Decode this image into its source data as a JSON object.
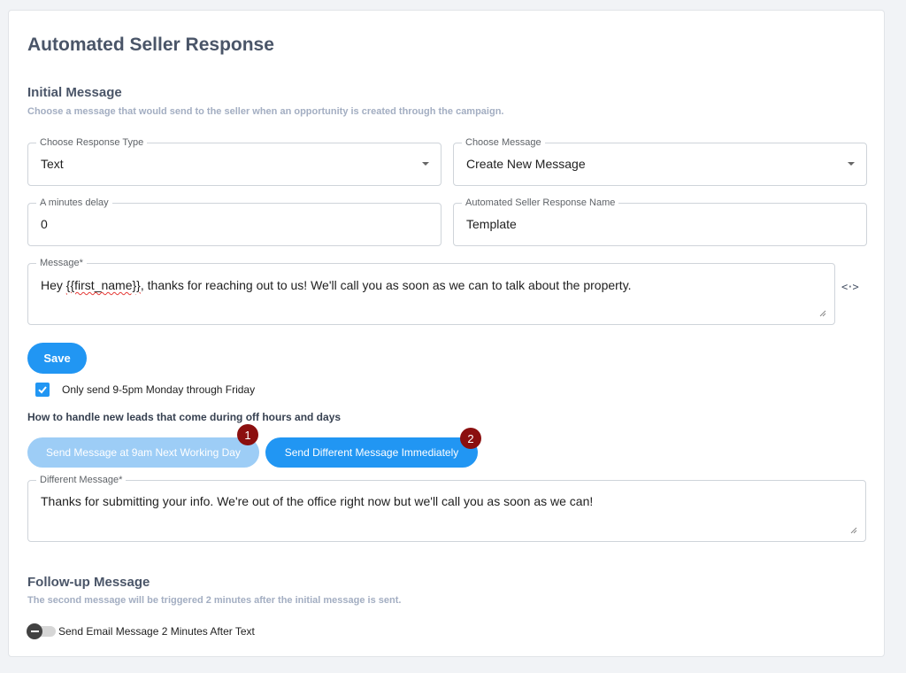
{
  "page_title": "Automated Seller Response",
  "initial": {
    "title": "Initial Message",
    "subtitle": "Choose a message that would send to the seller when an opportunity is created through the campaign."
  },
  "fields": {
    "response_type": {
      "label": "Choose Response Type",
      "value": "Text"
    },
    "choose_message": {
      "label": "Choose Message",
      "value": "Create New Message"
    },
    "delay": {
      "label": "A minutes delay",
      "value": "0"
    },
    "response_name": {
      "label": "Automated Seller Response Name",
      "value": "Template"
    },
    "message": {
      "label": "Message*",
      "value_pre": "Hey ",
      "value_var": "{{first_name}}",
      "value_post": ", thanks for reaching out to us! We'll call you as soon as we can to talk about the property."
    },
    "different_message": {
      "label": "Different Message*",
      "value": "Thanks for submitting your info. We're out of the office right now but we'll call you as soon as we can!"
    }
  },
  "code_icon_glyph": "<·>",
  "save_label": "Save",
  "checkbox": {
    "label": "Only send 9-5pm Monday through Friday",
    "checked": true
  },
  "off_hours_question": "How to handle new leads that come during off hours and days",
  "options": [
    {
      "label": "Send Message at 9am Next Working Day",
      "badge": "1"
    },
    {
      "label": "Send Different Message Immediately",
      "badge": "2"
    }
  ],
  "followup": {
    "title": "Follow-up Message",
    "subtitle": "The second message will be triggered 2 minutes after the initial message is sent.",
    "toggle_label": "Send Email Message 2 Minutes After Text"
  },
  "colors": {
    "primary": "#2196f3",
    "primary_light": "#9dcdf6",
    "badge": "#8b0f0f",
    "heading": "#4a5568",
    "subtext": "#a3aec2"
  }
}
